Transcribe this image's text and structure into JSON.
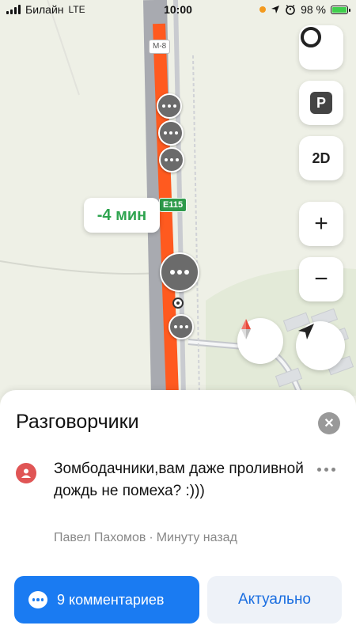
{
  "status_bar": {
    "carrier": "Билайн",
    "network": "LTE",
    "time": "10:00",
    "battery_percent": "98 %",
    "battery_level": 0.98,
    "colors": {
      "location_dot": "#f39a1e",
      "battery": "#3fcf4c"
    }
  },
  "map": {
    "eta_label": "-4 мин",
    "road_sign_e115": "E115",
    "road_sign_m8": "M-8",
    "controls": {
      "alice_icon": "ring-icon",
      "parking_label": "P",
      "view_mode_label": "2D",
      "zoom_in_label": "+",
      "zoom_out_label": "−"
    },
    "colors": {
      "route": "#ff5a1f",
      "road": "#a8aab0",
      "eta_text": "#2ea44f",
      "sign_e115": "#2e9a4a"
    }
  },
  "sheet": {
    "title": "Разговорчики",
    "message": {
      "text": "Зомбодачники,вам даже проливной дождь не помеха? :)))",
      "author": "Павел Пахомов",
      "separator": "·",
      "time": "Минуту назад"
    },
    "comments_button": "9 комментариев",
    "actual_button": "Актуально",
    "colors": {
      "primary": "#1a7bf2",
      "avatar": "#e05555"
    }
  }
}
